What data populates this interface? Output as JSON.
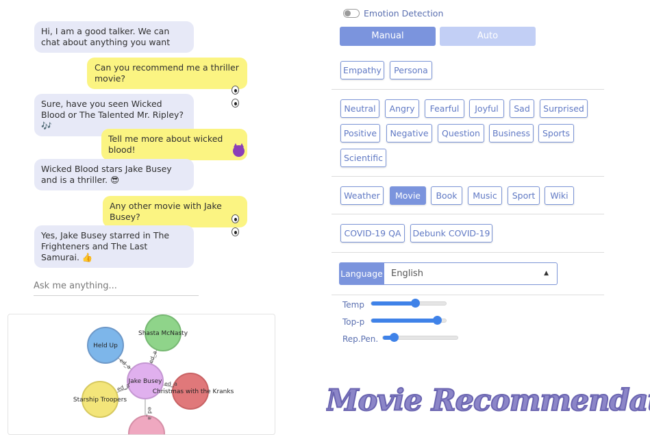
{
  "chat": {
    "messages": [
      {
        "role": "bot",
        "text": "Hi, I am a good talker. We can chat about anything you want"
      },
      {
        "role": "user",
        "text": "Can you recommend me a thriller movie?"
      },
      {
        "role": "bot",
        "text": "Sure, have you seen Wicked Blood or The Talented Mr. Ripley? 🎶"
      },
      {
        "role": "user",
        "text": "Tell me more about wicked blood!"
      },
      {
        "role": "bot",
        "text": "Wicked Blood stars Jake Busey and is a thriller. 😎"
      },
      {
        "role": "user",
        "text": "Any other movie with Jake Busey?"
      },
      {
        "role": "bot",
        "text": "Yes, Jake Busey starred in The Frighteners and The Last Samurai. 👍"
      }
    ],
    "input_placeholder": "Ask me anything..."
  },
  "graph": {
    "center": "Jake Busey",
    "nodes": [
      "Held Up",
      "Shasta McNasty",
      "Christmas with the Kranks",
      "Starship Troopers"
    ],
    "edge_labels": [
      "ed_a",
      "ed_a",
      "ed_a",
      "ed_a",
      "ed_a"
    ],
    "colors": {
      "held_up": "#7db6ea",
      "shasta": "#8fd48a",
      "christmas": "#e0787a",
      "starship": "#f3e57a",
      "jake": "#e0b0ee",
      "bottom": "#efa8c0"
    }
  },
  "controls": {
    "emotion_detection_label": "Emotion Detection",
    "mode_buttons": [
      "Manual",
      "Auto"
    ],
    "personality_buttons": [
      "Empathy",
      "Persona"
    ],
    "emotion_buttons": [
      "Neutral",
      "Angry",
      "Fearful",
      "Joyful",
      "Sad",
      "Surprised",
      "Positive",
      "Negative",
      "Question",
      "Business",
      "Sports",
      "Scientific"
    ],
    "topic_buttons": [
      "Weather",
      "Movie",
      "Book",
      "Music",
      "Sport",
      "Wiki"
    ],
    "covid_buttons": [
      "COVID-19 QA",
      "Debunk COVID-19"
    ],
    "language_label": "Language",
    "language_value": "English",
    "sliders": [
      {
        "label": "Temp",
        "value": 0.58
      },
      {
        "label": "Top-p",
        "value": 0.86
      },
      {
        "label": "Rep.Pen.",
        "value": 0.05
      }
    ]
  },
  "banner": "Movie Recommendation"
}
